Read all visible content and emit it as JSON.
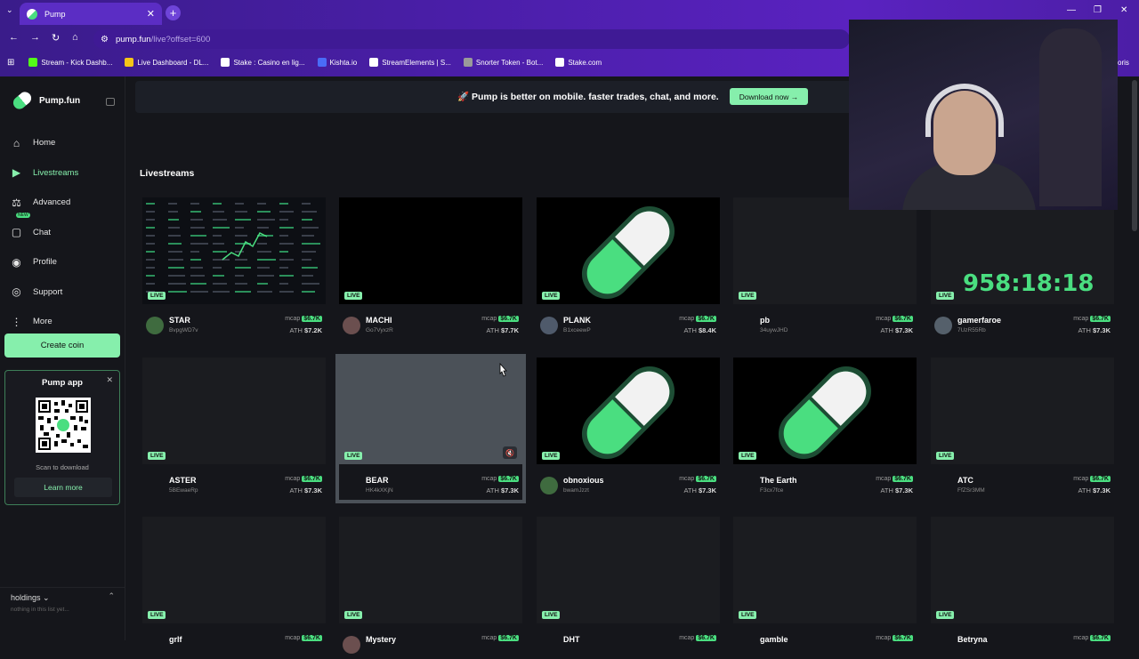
{
  "browser": {
    "tab_title": "Pump",
    "url_host": "pump.fun",
    "url_path": "/live?offset=600",
    "bookmarks": [
      {
        "label": "Stream - Kick Dashb...",
        "color": "#53fc18"
      },
      {
        "label": "Live Dashboard - DL...",
        "color": "#f5c518"
      },
      {
        "label": "Stake : Casino en lig...",
        "color": "#ffffff"
      },
      {
        "label": "Kishta.io",
        "color": "#4a6cf7"
      },
      {
        "label": "StreamElements | S...",
        "color": "#ffffff"
      },
      {
        "label": "Snorter Token - Bot...",
        "color": "#9a9a9a"
      },
      {
        "label": "Stake.com",
        "color": "#ffffff"
      }
    ],
    "bookmarks_overflow": "voris"
  },
  "sidebar": {
    "brand": "Pump.fun",
    "nav": [
      {
        "label": "Home",
        "icon": "home-icon",
        "glyph": "⌂"
      },
      {
        "label": "Livestreams",
        "icon": "video-camera-icon",
        "glyph": "▶",
        "active": true
      },
      {
        "label": "Advanced",
        "icon": "advanced-icon",
        "glyph": "⚖"
      },
      {
        "label": "Chat",
        "icon": "chat-icon",
        "glyph": "▢",
        "badge": "NEW"
      },
      {
        "label": "Profile",
        "icon": "profile-icon",
        "glyph": "◉"
      },
      {
        "label": "Support",
        "icon": "support-icon",
        "glyph": "◎"
      },
      {
        "label": "More",
        "icon": "more-icon",
        "glyph": "⋮"
      }
    ],
    "create_coin": "Create coin",
    "app_card": {
      "title": "Pump app",
      "scan": "Scan to download",
      "learn": "Learn more"
    },
    "holdings": {
      "title": "holdings",
      "empty": "nothing in this list yet..."
    }
  },
  "banner": {
    "text": "🚀 Pump is better on mobile. faster trades, chat, and more.",
    "button": "Download now →"
  },
  "section_title": "Livestreams",
  "live_label": "LIVE",
  "mcap_label": "mcap",
  "ath_label": "ATH",
  "streams": [
    {
      "name": "STAR",
      "symbol": "BvpgWD7v",
      "mcap": "$6.7K",
      "ath": "$7.2K",
      "thumb": "screen",
      "avatar": "#3f6b3f"
    },
    {
      "name": "MACHI",
      "symbol": "Go7VyxzR",
      "mcap": "$6.7K",
      "ath": "$7.7K",
      "thumb": "dark",
      "avatar": "#6b4f4f"
    },
    {
      "name": "PLANK",
      "symbol": "B1xceewP",
      "mcap": "$6.7K",
      "ath": "$8.4K",
      "thumb": "pill",
      "avatar": "#4f5a6b"
    },
    {
      "name": "pb",
      "symbol": "34uywJHD",
      "mcap": "$6.7K",
      "ath": "$7.3K",
      "thumb": "blank",
      "avatar": ""
    },
    {
      "name": "gamerfaroe",
      "symbol": "7UzR55Rb",
      "mcap": "$6.7K",
      "ath": "$7.3K",
      "thumb": "timer",
      "timer": "958:18:18",
      "avatar": "#55606b"
    },
    {
      "name": "ASTER",
      "symbol": "5BEwaeRp",
      "mcap": "$6.7K",
      "ath": "$7.3K",
      "thumb": "blank",
      "avatar": ""
    },
    {
      "name": "BEAR",
      "symbol": "HK4kXKjN",
      "mcap": "$6.7K",
      "ath": "$7.3K",
      "thumb": "hover",
      "avatar": ""
    },
    {
      "name": "obnoxious",
      "symbol": "bwamJzzt",
      "mcap": "$6.7K",
      "ath": "$7.3K",
      "thumb": "pill",
      "avatar": "#3f6b3f"
    },
    {
      "name": "The Earth",
      "symbol": "F3cx7fce",
      "mcap": "$6.7K",
      "ath": "$7.3K",
      "thumb": "pill",
      "avatar": ""
    },
    {
      "name": "ATC",
      "symbol": "FfZSr3MM",
      "mcap": "$6.7K",
      "ath": "$7.3K",
      "thumb": "blank",
      "avatar": ""
    },
    {
      "name": "grlf",
      "symbol": "",
      "mcap": "$6.7K",
      "ath": "",
      "thumb": "blank",
      "avatar": ""
    },
    {
      "name": "Mystery",
      "symbol": "",
      "mcap": "$6.7K",
      "ath": "",
      "thumb": "blank",
      "avatar": "#6b4f4f"
    },
    {
      "name": "DHT",
      "symbol": "",
      "mcap": "$6.7K",
      "ath": "",
      "thumb": "blank",
      "avatar": ""
    },
    {
      "name": "gamble",
      "symbol": "",
      "mcap": "$6.7K",
      "ath": "",
      "thumb": "blank",
      "avatar": ""
    },
    {
      "name": "Betryna",
      "symbol": "",
      "mcap": "$6.7K",
      "ath": "",
      "thumb": "blank",
      "avatar": ""
    }
  ]
}
